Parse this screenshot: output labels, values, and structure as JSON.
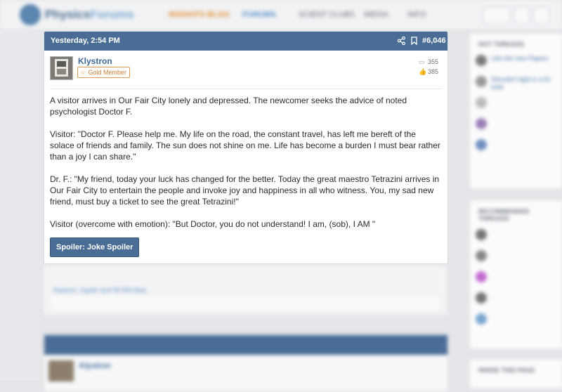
{
  "nav": {
    "brand_a": "Physics",
    "brand_b": "Forums",
    "insights": "INSIGHTS BLOG",
    "forums": "FORUMS",
    "ask": "SCIENT CLUBS",
    "media": "MEDIA",
    "info": "INFO"
  },
  "sidebar": {
    "hot_threads": "HOT THREADS",
    "hot_items": [
      "Like the new Papers",
      "Shouldn't light in a fix hold"
    ],
    "recommended": "RECOMMENDED THREADS",
    "rec_items": [
      "...",
      "..."
    ],
    "bottom": "INSIDE THIS PAGE"
  },
  "post": {
    "date": "Yesterday, 2:54 PM",
    "number": "#6,046",
    "username": "Klystron",
    "badge": "Gold Member",
    "messages": "355",
    "likes": "385",
    "paragraphs": [
      "A visitor arrives in Our Fair City lonely and depressed. The newcomer seeks the advice of noted psychologist Doctor F.",
      "Visitor: \"Doctor F. Please help me. My life on the road, the constant travel, has left me bereft of the solace of friends and family. The sun does not shine on me. Life has become a burden I must bear rather than a joy I can share.\"",
      "Dr. F.: \"My friend, today your luck has changed for the better. Today the great maestro Tetrazini arrives in Our Fair City to entertain the people and invoke joy and happiness in all who witness. You, my sad new friend, must buy a ticket to see the great Tetrazini!\"",
      "Visitor (overcome with emotion): \"But Doctor, you do not understand! I am, (sob), I AM \""
    ],
    "spoiler": "Spoiler: Joke Spoiler"
  },
  "footer": {
    "reactions": "Klystron, Jupiter and 99.999 likes"
  },
  "post2": {
    "username": "Klystron"
  }
}
